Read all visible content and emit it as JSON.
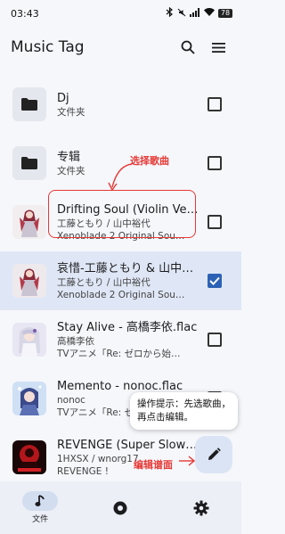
{
  "status_bar": {
    "time": "03:43",
    "battery": "78"
  },
  "app_bar": {
    "title": "Music Tag"
  },
  "items": [
    {
      "title": "Dj",
      "sub1": "文件夹",
      "sub2": "",
      "type": "folder",
      "checked": false
    },
    {
      "title": "专辑",
      "sub1": "文件夹",
      "sub2": "",
      "type": "folder",
      "checked": false
    },
    {
      "title": "Drifting Soul (Violin Ve…",
      "sub1": "工藤ともり / 山中裕代",
      "sub2": "Xenoblade 2 Original Sou…",
      "type": "song",
      "checked": false
    },
    {
      "title": "哀惜-工藤ともり & 山中…",
      "sub1": "工藤ともり / 山中裕代",
      "sub2": "Xenoblade 2 Original Sou…",
      "type": "song",
      "checked": true
    },
    {
      "title": "Stay Alive - 高橋李依.flac",
      "sub1": "高橋李依",
      "sub2": "TVアニメ「Re: ゼロから始…",
      "type": "song",
      "checked": false
    },
    {
      "title": "Memento - nonoc.flac",
      "sub1": "nonoc",
      "sub2": "TVアニメ「Re: ゼ…",
      "type": "song",
      "checked": false
    },
    {
      "title": "REVENGE (Super Slow…",
      "sub1": "1HXSX / wnorg17",
      "sub2": "REVENGE !",
      "type": "song",
      "checked": false
    }
  ],
  "annotations": {
    "select_song": "选择歌曲",
    "tooltip_line1": "操作提示：先选歌曲，",
    "tooltip_line2": "再点击编辑。",
    "edit_tag": "编辑谱面"
  },
  "bottom_nav": {
    "files_label": "文件"
  },
  "colors": {
    "accent": "#2c62b5",
    "annotation_red": "#e53935",
    "selected_row": "#dfe7f6"
  }
}
